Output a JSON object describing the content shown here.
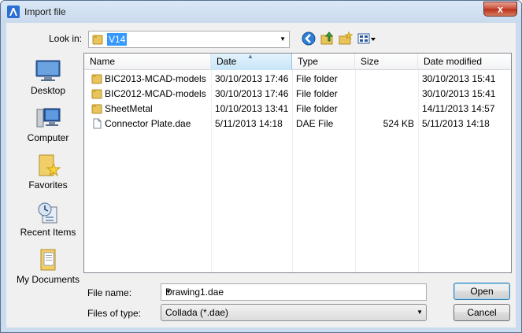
{
  "window": {
    "title": "Import file",
    "close_glyph": "x"
  },
  "lookin": {
    "label": "Look in:",
    "value": "V14"
  },
  "toolbar": {
    "icons": [
      "back-icon",
      "up-folder-icon",
      "new-folder-icon",
      "view-menu-icon"
    ]
  },
  "places": [
    {
      "label": "Desktop",
      "icon": "desktop-icon"
    },
    {
      "label": "Computer",
      "icon": "computer-icon"
    },
    {
      "label": "Favorites",
      "icon": "favorites-icon"
    },
    {
      "label": "Recent Items",
      "icon": "recent-items-icon"
    },
    {
      "label": "My Documents",
      "icon": "my-documents-icon"
    }
  ],
  "columns": [
    "Name",
    "Date",
    "Type",
    "Size",
    "Date modified"
  ],
  "files": [
    {
      "name": "BIC2013-MCAD-models",
      "date": "30/10/2013 17:46",
      "type": "File folder",
      "size": "",
      "modified": "30/10/2013 15:41",
      "icon": "folder-icon"
    },
    {
      "name": "BIC2012-MCAD-models",
      "date": "30/10/2013 17:46",
      "type": "File folder",
      "size": "",
      "modified": "30/10/2013 15:41",
      "icon": "folder-icon"
    },
    {
      "name": "SheetMetal",
      "date": "10/10/2013 13:41",
      "type": "File folder",
      "size": "",
      "modified": "14/11/2013 14:57",
      "icon": "folder-icon"
    },
    {
      "name": "Connector Plate.dae",
      "date": "5/11/2013 14:18",
      "type": "DAE File",
      "size": "524 KB",
      "modified": "5/11/2013 14:18",
      "icon": "file-icon"
    }
  ],
  "filename": {
    "label": "File name:",
    "value": "Drawing1.dae"
  },
  "filetype": {
    "label": "Files of type:",
    "value": "Collada (*.dae)"
  },
  "buttons": {
    "open": "Open",
    "cancel": "Cancel"
  },
  "colors": {
    "selection": "#3399ff",
    "folder": "#e8c45b",
    "chrome": "#cbdcee"
  }
}
